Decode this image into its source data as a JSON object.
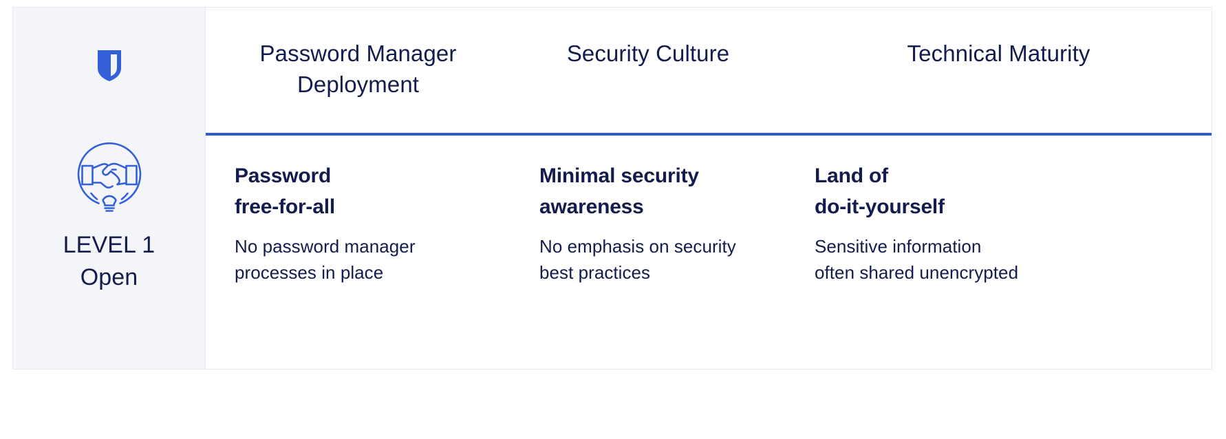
{
  "brand": {
    "logo_icon": "shield-icon",
    "logo_color": "#3360d9"
  },
  "sidebar": {
    "level_icon": "handshake-lightbulb-icon",
    "level_icon_color": "#3360d9",
    "level_number": "LEVEL 1",
    "level_name": "Open",
    "background_color": "#f3f5f9",
    "text_color": "#131c4d"
  },
  "table": {
    "divider_color": "#2c5bd4",
    "columns": [
      {
        "header": "Password Manager Deployment",
        "title": "Password\nfree-for-all",
        "description": "No password manager processes in place"
      },
      {
        "header": "Security Culture",
        "title": "Minimal security awareness",
        "description": "No emphasis on security best practices"
      },
      {
        "header": "Technical Maturity",
        "title": "Land of\ndo-it-yourself",
        "description": "Sensitive information often shared unencrypted"
      }
    ]
  }
}
